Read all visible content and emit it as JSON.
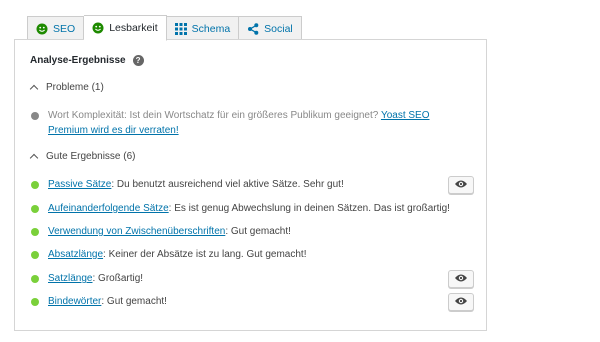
{
  "tabs": [
    {
      "label": "SEO",
      "icon": "smiley-green-icon",
      "active": false
    },
    {
      "label": "Lesbarkeit",
      "icon": "smiley-green-icon",
      "active": true
    },
    {
      "label": "Schema",
      "icon": "grid-icon",
      "active": false
    },
    {
      "label": "Social",
      "icon": "share-icon",
      "active": false
    }
  ],
  "analysis": {
    "heading": "Analyse-Ergebnisse",
    "help_icon_text": "?"
  },
  "problems": {
    "title": "Probleme (1)",
    "items": [
      {
        "text": "Wort Komplexität: Ist dein Wortschatz für ein größeres Publikum geeignet? ",
        "link": "Yoast SEO Premium wird es dir verraten!",
        "status": "gray"
      }
    ]
  },
  "good": {
    "title": "Gute Ergebnisse (6)",
    "items": [
      {
        "link": "Passive Sätze",
        "text": ": Du benutzt ausreichend viel aktive Sätze. Sehr gut!",
        "status": "green",
        "has_eye": true
      },
      {
        "link": "Aufeinanderfolgende Sätze",
        "text": ": Es ist genug Abwechslung in deinen Sätzen. Das ist großartig!",
        "status": "green",
        "has_eye": false
      },
      {
        "link": "Verwendung von Zwischenüberschriften",
        "text": ": Gut gemacht!",
        "status": "green",
        "has_eye": false
      },
      {
        "link": "Absatzlänge",
        "text": ": Keiner der Absätze ist zu lang. Gut gemacht!",
        "status": "green",
        "has_eye": false
      },
      {
        "link": "Satzlänge",
        "text": ": Großartig!",
        "status": "green",
        "has_eye": true
      },
      {
        "link": "Bindewörter",
        "text": ": Gut gemacht!",
        "status": "green",
        "has_eye": true
      }
    ]
  },
  "colors": {
    "link": "#0073aa",
    "good": "#7ad03a",
    "neutral": "#888888",
    "smiley": "#1e8a00"
  }
}
